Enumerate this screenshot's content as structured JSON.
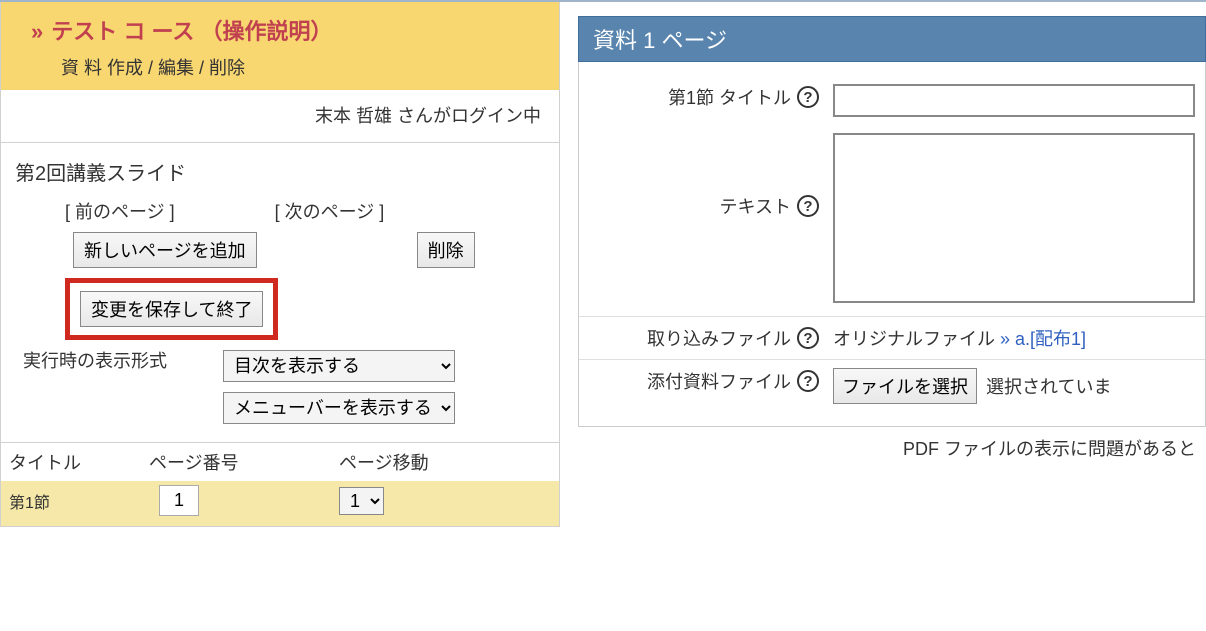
{
  "course": {
    "title": "テスト コ ース （操作説明）",
    "subtitle": "資 料  作成 / 編集 / 削除"
  },
  "login": {
    "status": "末本  哲雄 さんがログイン中"
  },
  "slide": {
    "title": "第2回講義スライド",
    "prev_page": "[ 前のページ ]",
    "next_page": "[ 次のページ ]",
    "add_page_btn": "新しいページを追加",
    "delete_btn": "削除",
    "save_exit_btn": "変更を保存して終了",
    "display_format_label": "実行時の表示形式",
    "display_toc_option": "目次を表示する",
    "display_menu_option": "メニューバーを表示する"
  },
  "title_table": {
    "col_title": "タイトル",
    "col_pagenum": "ページ番号",
    "col_pagemove": "ページ移動",
    "row1_section": "第1節",
    "row1_pagenum": "1",
    "row1_pagemove": "1"
  },
  "right": {
    "header": "資料 1 ページ",
    "section_title_label": "第1節 タイトル",
    "text_label": "テキスト",
    "import_file_label": "取り込みファイル",
    "import_file_value_prefix": "オリジナルファイル ",
    "import_file_link": "» a.[配布1]",
    "attach_file_label": "添付資料ファイル",
    "file_select_btn": "ファイルを選択",
    "file_not_selected": "選択されていま",
    "pdf_note": "PDF ファイルの表示に問題があると"
  }
}
